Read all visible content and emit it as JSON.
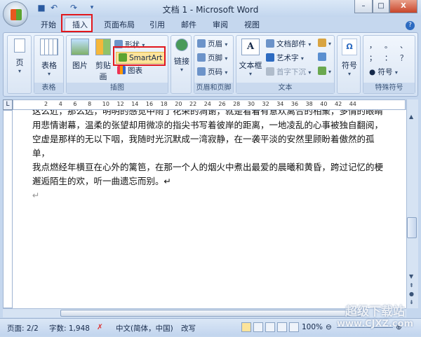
{
  "window": {
    "title": "文档 1 - Microsoft Word",
    "minimize": "–",
    "maximize": "□",
    "close": "X"
  },
  "tabs": [
    {
      "label": "开始"
    },
    {
      "label": "插入"
    },
    {
      "label": "页面布局"
    },
    {
      "label": "引用"
    },
    {
      "label": "邮件"
    },
    {
      "label": "审阅"
    },
    {
      "label": "视图"
    }
  ],
  "ribbon": {
    "pages": {
      "label": "页",
      "group": ""
    },
    "tables": {
      "label": "表格",
      "group": "表格"
    },
    "illustrations": {
      "group": "插图",
      "picture": "图片",
      "clipart": "剪贴画",
      "shapes": "形状",
      "smartart": "SmartArt",
      "chart": "图表"
    },
    "links": {
      "label": "链接"
    },
    "headerfooter": {
      "group": "页眉和页脚",
      "header": "页眉",
      "footer": "页脚",
      "pagenum": "页码"
    },
    "text": {
      "group": "文本",
      "textbox": "文本框",
      "quickparts": "文档部件",
      "wordart": "艺术字",
      "dropcap": "首字下沉"
    },
    "symbols": {
      "label": "符号"
    },
    "special": {
      "group": "特殊符号",
      "chars": [
        "，",
        "。",
        "、",
        "；",
        "：",
        "？"
      ],
      "symbol": "符号"
    }
  },
  "ruler": {
    "corner": "L",
    "ticks": [
      "2",
      "4",
      "6",
      "8",
      "10",
      "12",
      "14",
      "16",
      "18",
      "20",
      "22",
      "24",
      "26",
      "28",
      "30",
      "32",
      "34",
      "36",
      "38",
      "40",
      "42",
      "44"
    ]
  },
  "document": {
    "lines": [
      "这么近，那么远，明明的感觉中雨了花朵的凋谢，就是看着有意欢离合的相聚，多情的眼睛",
      "用悲情谢幕，温柔的张望却用微凉的指尖书写着彼岸的距离，一地凌乱的心事被独自翻阅，",
      "空虚是那样的无以下咽，我随时光沉默成一湾寂静，在一袭平淡的安然里顾盼着傲然的孤单，",
      "我点燃经年横亘在心外的篱笆，在那一个人的烟火中煮出最爱的晨曦和黄昏，跨过记忆的梗",
      "邂逅陌生的欢，听一曲遗忘而别。↵",
      "↵"
    ]
  },
  "status": {
    "page": "页面: 2/2",
    "words": "字数: 1,948",
    "language": "中文(简体，中国)",
    "mode": "改写",
    "zoom": "100%"
  },
  "watermark": {
    "line1": "超级下载站",
    "line2": "www.CJXZ.com"
  }
}
